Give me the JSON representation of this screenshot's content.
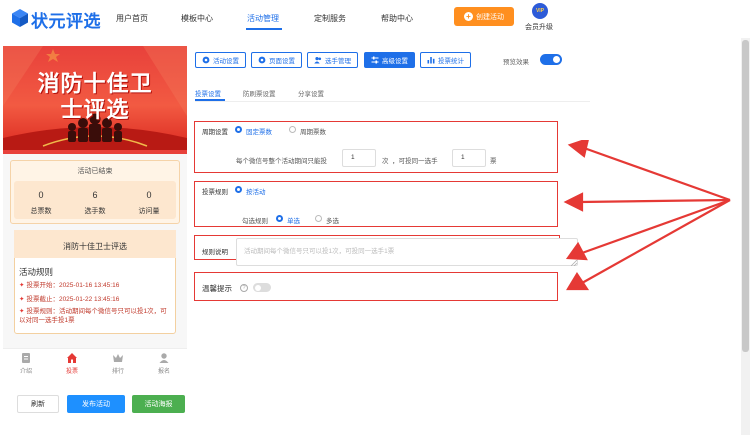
{
  "header": {
    "logo_text": "状元评选",
    "nav": [
      "用户首页",
      "模板中心",
      "活动管理",
      "定制服务",
      "帮助中心"
    ],
    "active_nav": "活动管理",
    "create_button": "创建活动",
    "vip_badge": "VIP",
    "vip_label": "会员升级",
    "brand_color": "#1e6fe8",
    "accent_color": "#ff8f1f"
  },
  "preview": {
    "banner_title_line1": "消防十佳卫",
    "banner_title_line2": "士评选",
    "status": "活动已结束",
    "stats": [
      {
        "value": "0",
        "label": "总票数"
      },
      {
        "value": "6",
        "label": "选手数"
      },
      {
        "value": "0",
        "label": "访问量"
      }
    ],
    "rule_card_title": "消防十佳卫士评选",
    "rules_title": "活动规则",
    "rules": [
      "投票开始：2025-01-16 13:45:16",
      "投票截止：2025-01-22 13:45:16",
      "投票规则：活动期间每个微信号只可以投1次，可以对同一选手投1票"
    ],
    "tabs": [
      {
        "label": "介绍",
        "icon": "document-icon"
      },
      {
        "label": "投票",
        "icon": "home-icon",
        "active": true
      },
      {
        "label": "排行",
        "icon": "crown-icon"
      },
      {
        "label": "报名",
        "icon": "person-icon"
      }
    ]
  },
  "actions": {
    "refresh": "刷新",
    "publish": "发布活动",
    "poster": "活动海报"
  },
  "toolbar": {
    "buttons": [
      {
        "label": "活动设置",
        "icon": "gear-icon"
      },
      {
        "label": "页面设置",
        "icon": "gear-icon"
      },
      {
        "label": "选手管理",
        "icon": "users-icon"
      },
      {
        "label": "高级设置",
        "icon": "sliders-icon",
        "active": true
      },
      {
        "label": "投票统计",
        "icon": "bar-chart-icon"
      }
    ],
    "preview_label": "预览效果",
    "preview_on": true
  },
  "subtabs": {
    "items": [
      "投票设置",
      "防刷票设置",
      "分享设置"
    ],
    "active": "投票设置"
  },
  "form": {
    "cycle": {
      "label": "周期设置",
      "options": [
        "固定票数",
        "周期票数"
      ],
      "selected": "固定票数",
      "sentence_prefix": "每个微信号整个活动期间只能投",
      "votes_total": "1",
      "sentence_mid": "次  ，可投同一选手",
      "votes_same": "1",
      "sentence_suffix": "票"
    },
    "rule": {
      "label": "投票规则",
      "option": "按活动",
      "check_label": "勾选规则",
      "check_options": [
        "单选",
        "多选"
      ],
      "check_selected": "单选"
    },
    "desc": {
      "label": "规则说明",
      "placeholder": "活动期间每个微信号只可以投1次，可投同一选手1票"
    },
    "tip": {
      "label": "温馨提示",
      "help": "?",
      "enabled": false
    }
  }
}
